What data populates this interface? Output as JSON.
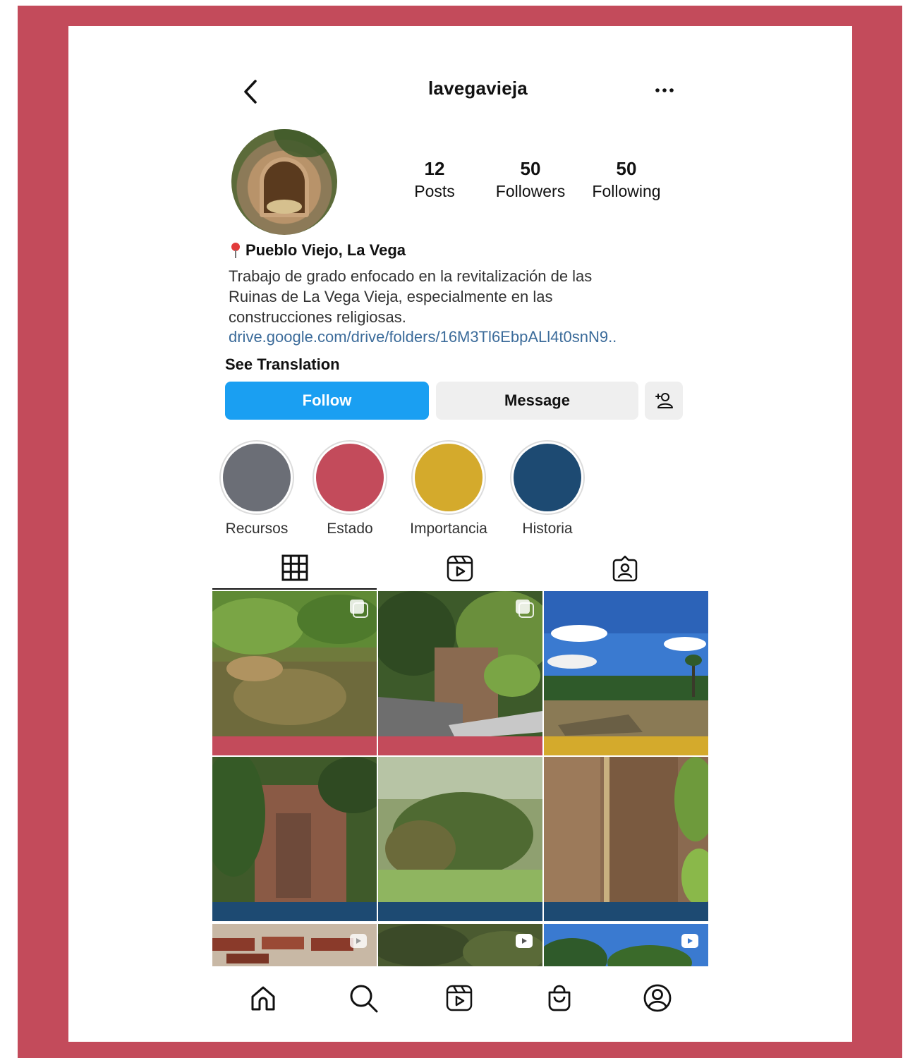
{
  "header": {
    "username": "lavegavieja"
  },
  "stats": [
    {
      "value": "12",
      "label": "Posts"
    },
    {
      "value": "50",
      "label": "Followers"
    },
    {
      "value": "50",
      "label": "Following"
    }
  ],
  "bio": {
    "location": "Pueblo Viejo, La Vega",
    "lines": [
      "Trabajo de grado enfocado en la revitalización de las",
      "Ruinas de La Vega Vieja, especialmente en las",
      "construcciones religiosas."
    ],
    "link": "drive.google.com/drive/folders/16M3Tl6EbpALl4t0snN9..",
    "see_translation": "See Translation"
  },
  "actions": {
    "follow": "Follow",
    "message": "Message"
  },
  "highlights": [
    {
      "name": "Recursos",
      "color": "#6b6e76"
    },
    {
      "name": "Estado",
      "color": "#c34b5b"
    },
    {
      "name": "Importancia",
      "color": "#d4aa2c"
    },
    {
      "name": "Historia",
      "color": "#1d4a72"
    }
  ],
  "colors": {
    "frame": "#c34b5b",
    "follow_button": "#1a9ff2",
    "link": "#3b6b9a"
  },
  "tabs": [
    "grid-icon",
    "reels-icon",
    "tagged-icon"
  ],
  "grid_strips": [
    "#c34b5b",
    "#c34b5b",
    "#d4aa2c",
    "#1d4a72",
    "#1d4a72",
    "#1d4a72"
  ],
  "nav": [
    "home-icon",
    "search-icon",
    "reels-icon",
    "shop-icon",
    "profile-icon"
  ]
}
